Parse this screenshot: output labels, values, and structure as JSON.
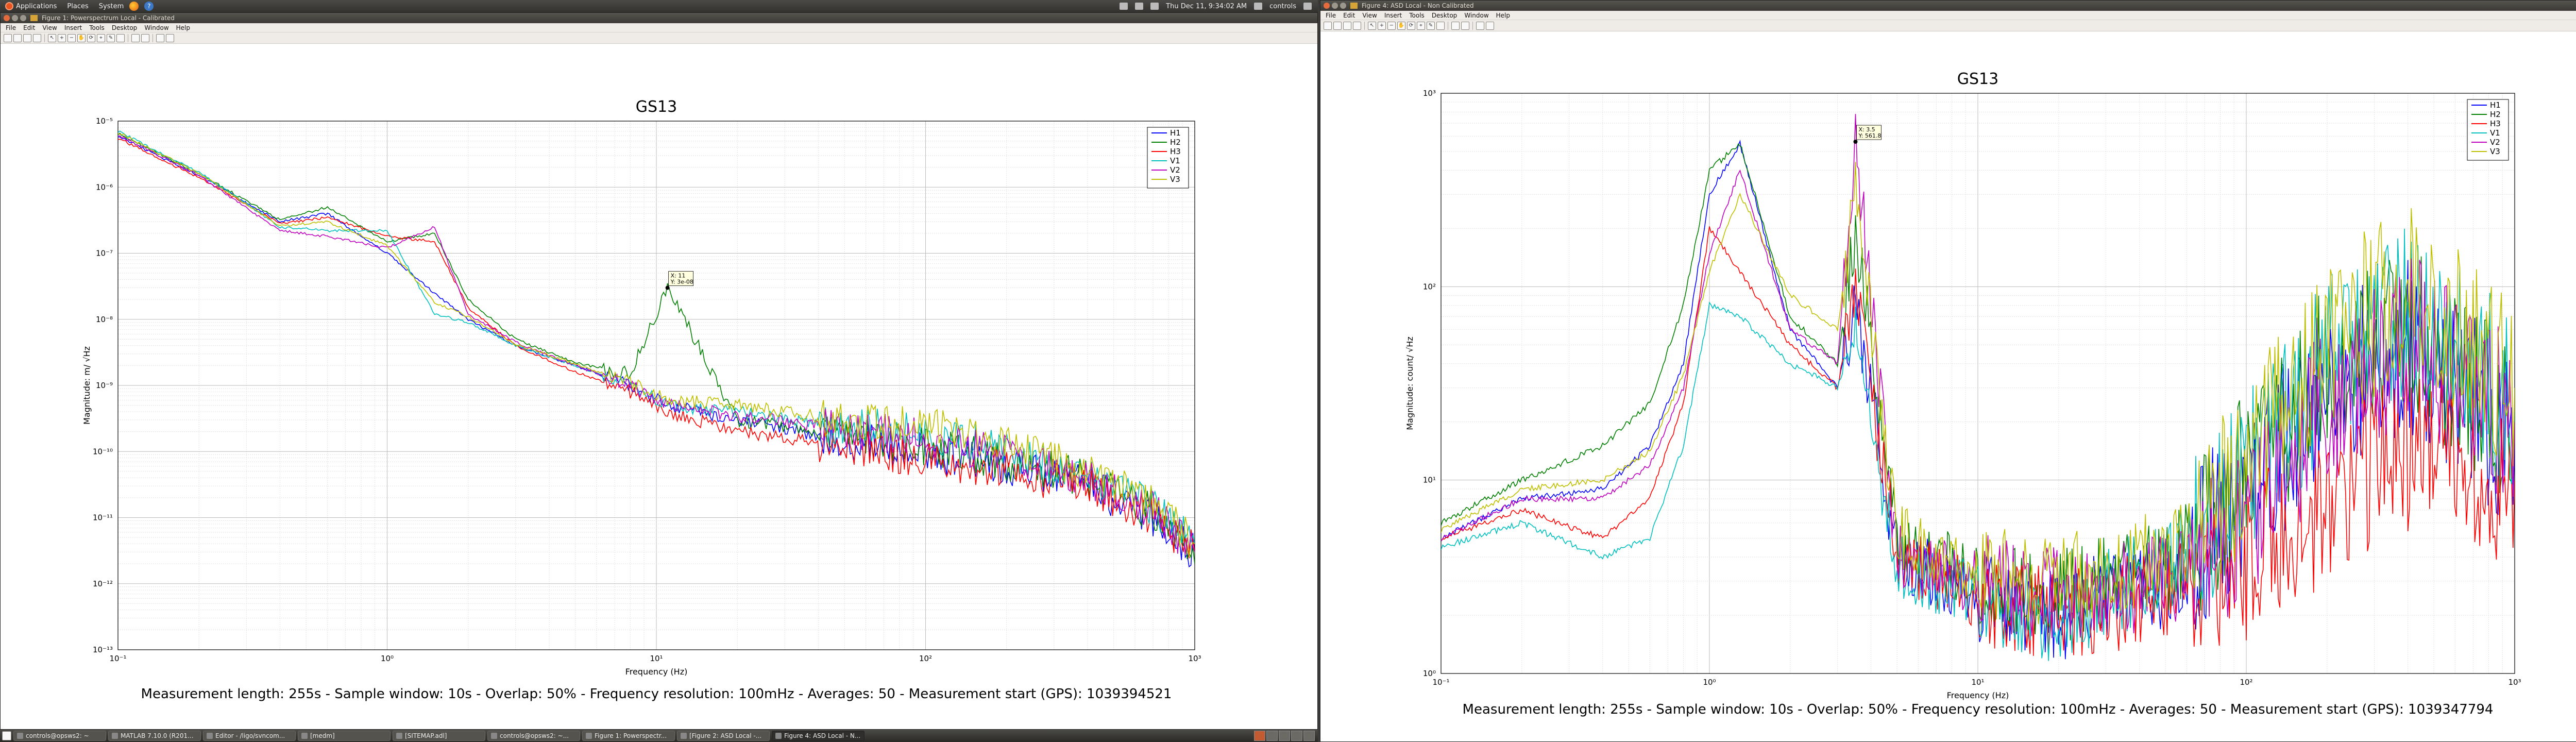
{
  "top_panel": {
    "menus": [
      "Applications",
      "Places",
      "System"
    ],
    "clock": "Thu Dec 11, 9:34:02 AM",
    "user": "controls"
  },
  "taskbar": {
    "tasks": [
      {
        "label": "controls@opsws2: ~",
        "active": false
      },
      {
        "label": "MATLAB 7.10.0 (R201...",
        "active": false
      },
      {
        "label": "Editor - /ligo/svncom...",
        "active": false
      },
      {
        "label": "[medm]",
        "active": false
      },
      {
        "label": "[SITEMAP.adl]",
        "active": false
      },
      {
        "label": "controls@opsws2: ~...",
        "active": false
      },
      {
        "label": "Figure 1: Powerspectr...",
        "active": false
      },
      {
        "label": "[Figure 2: ASD Local -...",
        "active": false
      },
      {
        "label": "Figure 4: ASD Local - N...",
        "active": true
      }
    ]
  },
  "windows": [
    {
      "title": "Figure 1: Powerspectrum Local - Calibrated",
      "menus": [
        "File",
        "Edit",
        "View",
        "Insert",
        "Tools",
        "Desktop",
        "Window",
        "Help"
      ],
      "plot": {
        "title": "GS13",
        "xlabel": "Frequency (Hz)",
        "ylabel": "Magnitude: m/ √Hz",
        "footer": "Measurement length: 255s - Sample window: 10s - Overlap: 50% - Frequency resolution: 100mHz - Averages: 50 - Measurement start (GPS): 1039394521",
        "datatip": [
          "X: 11",
          "Y: 3e-08"
        ],
        "xticks": [
          "10⁻¹",
          "10⁰",
          "10¹",
          "10²",
          "10³"
        ],
        "yticks": [
          "10⁻⁵",
          "10⁻⁶",
          "10⁻⁷",
          "10⁻⁸",
          "10⁻⁹",
          "10⁻¹⁰",
          "10⁻¹¹",
          "10⁻¹²",
          "10⁻¹³"
        ],
        "legend": [
          "H1",
          "H2",
          "H3",
          "V1",
          "V2",
          "V3"
        ]
      }
    },
    {
      "title": "Figure 4: ASD Local - Non Calibrated",
      "menus": [
        "File",
        "Edit",
        "View",
        "Insert",
        "Tools",
        "Desktop",
        "Window",
        "Help"
      ],
      "plot": {
        "title": "GS13",
        "xlabel": "Frequency (Hz)",
        "ylabel": "Magnitude: count/ √Hz",
        "footer": "Measurement length: 255s - Sample window: 10s - Overlap: 50% - Frequency resolution: 100mHz - Averages: 50 - Measurement start (GPS): 1039347794",
        "datatip": [
          "X: 3.5",
          "Y: 561.8"
        ],
        "xticks": [
          "10⁻¹",
          "10⁰",
          "10¹",
          "10²",
          "10³"
        ],
        "yticks": [
          "10³",
          "10²",
          "10¹",
          "10⁰"
        ],
        "legend": [
          "H1",
          "H2",
          "H3",
          "V1",
          "V2",
          "V3"
        ]
      }
    }
  ],
  "colors": {
    "H1": "#0000ff",
    "H2": "#007f00",
    "H3": "#ff0000",
    "V1": "#00bfbf",
    "V2": "#bf00bf",
    "V3": "#bfbf00"
  },
  "chart_data": [
    {
      "type": "line",
      "title": "GS13",
      "xlabel": "Frequency (Hz)",
      "ylabel": "Magnitude: m/ √Hz",
      "x_scale": "log",
      "y_scale": "log",
      "xlim": [
        0.1,
        1000
      ],
      "ylim": [
        1e-13,
        1e-05
      ],
      "grid": true,
      "legend_position": "top-right",
      "x": [
        0.1,
        0.2,
        0.4,
        0.6,
        1,
        1.5,
        2,
        3,
        5,
        8,
        11,
        20,
        50,
        100,
        200,
        400,
        700,
        1000
      ],
      "series": [
        {
          "name": "H1",
          "values": [
            6e-06,
            1.5e-06,
            3e-07,
            4e-07,
            1e-07,
            2.5e-08,
            1e-08,
            4e-09,
            2e-09,
            1e-09,
            5e-10,
            3e-10,
            1.5e-10,
            1e-10,
            6e-11,
            3e-11,
            1e-11,
            3e-12
          ]
        },
        {
          "name": "H2",
          "values": [
            6.5e-06,
            1.6e-06,
            3.2e-07,
            5e-07,
            1.5e-07,
            2e-07,
            2e-08,
            5e-09,
            2.2e-09,
            1.5e-09,
            3e-08,
            3e-10,
            1.8e-10,
            1.2e-10,
            7e-11,
            4e-11,
            1.2e-11,
            2e-12
          ]
        },
        {
          "name": "H3",
          "values": [
            5.5e-06,
            1.4e-06,
            2.8e-07,
            3.5e-07,
            1.8e-07,
            1.5e-07,
            1.5e-08,
            4e-09,
            1.6e-09,
            8e-10,
            4e-10,
            2e-10,
            1.2e-10,
            8e-11,
            5e-11,
            3e-11,
            1e-11,
            3e-12
          ]
        },
        {
          "name": "V1",
          "values": [
            7e-06,
            1.7e-06,
            2.5e-07,
            2.2e-07,
            2.2e-07,
            1.2e-08,
            9e-09,
            4e-09,
            2e-09,
            1e-09,
            5e-10,
            4e-10,
            2.5e-10,
            2e-10,
            1e-10,
            4e-11,
            1.5e-11,
            4e-12
          ]
        },
        {
          "name": "V2",
          "values": [
            6.2e-06,
            1.5e-06,
            2.2e-07,
            1.8e-07,
            1.2e-07,
            2.5e-07,
            1.2e-08,
            4.5e-09,
            2e-09,
            1e-09,
            5e-10,
            3.5e-10,
            2.2e-10,
            1.6e-10,
            9e-11,
            4e-11,
            1.3e-11,
            3e-12
          ]
        },
        {
          "name": "V3",
          "values": [
            6.8e-06,
            1.6e-06,
            2.6e-07,
            3e-07,
            1.3e-07,
            1.8e-08,
            1.1e-08,
            4.2e-09,
            2.1e-09,
            1.1e-09,
            6e-10,
            5e-10,
            3e-10,
            2.5e-10,
            1.2e-10,
            5e-11,
            1.6e-11,
            4e-12
          ]
        }
      ]
    },
    {
      "type": "line",
      "title": "GS13",
      "xlabel": "Frequency (Hz)",
      "ylabel": "Magnitude: count/ √Hz",
      "x_scale": "log",
      "y_scale": "log",
      "xlim": [
        0.1,
        1000
      ],
      "ylim": [
        1,
        1000
      ],
      "grid": true,
      "legend_position": "top-right",
      "x": [
        0.1,
        0.2,
        0.4,
        0.6,
        0.8,
        1,
        1.3,
        2,
        3,
        3.5,
        5,
        10,
        20,
        50,
        100,
        200,
        400,
        700,
        1000
      ],
      "series": [
        {
          "name": "H1",
          "values": [
            5,
            8,
            9,
            15,
            40,
            300,
            550,
            60,
            30,
            80,
            4,
            2.5,
            2,
            3,
            8,
            30,
            50,
            25,
            15
          ]
        },
        {
          "name": "H2",
          "values": [
            6,
            10,
            15,
            25,
            80,
            400,
            550,
            70,
            40,
            200,
            5,
            3,
            2.5,
            3.5,
            10,
            40,
            60,
            30,
            20
          ]
        },
        {
          "name": "H3",
          "values": [
            5,
            7,
            5,
            8,
            25,
            200,
            120,
            50,
            30,
            100,
            4,
            2.5,
            2,
            2.5,
            4,
            8,
            15,
            12,
            10
          ]
        },
        {
          "name": "V1",
          "values": [
            4.5,
            6,
            4,
            5,
            15,
            80,
            70,
            40,
            30,
            60,
            3.5,
            2.5,
            2,
            3.5,
            10,
            40,
            80,
            40,
            25
          ]
        },
        {
          "name": "V2",
          "values": [
            5,
            8,
            8,
            12,
            30,
            150,
            400,
            60,
            40,
            561.8,
            4,
            3,
            2.5,
            3,
            6,
            25,
            60,
            30,
            20
          ]
        },
        {
          "name": "V3",
          "values": [
            5.5,
            9,
            10,
            14,
            35,
            120,
            300,
            90,
            60,
            300,
            5,
            3.5,
            3,
            4,
            12,
            50,
            100,
            50,
            30
          ]
        }
      ]
    }
  ]
}
